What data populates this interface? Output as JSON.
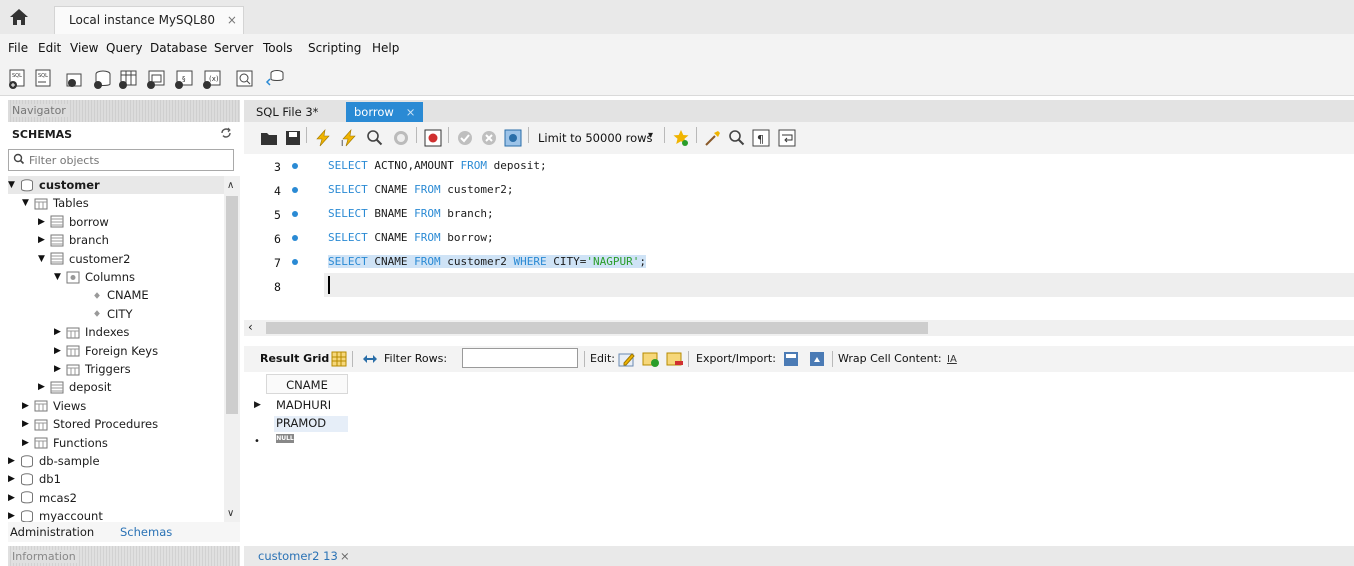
{
  "app": {
    "connection_tab": "Local instance MySQL80",
    "close_glyph": "×"
  },
  "menu": [
    "File",
    "Edit",
    "View",
    "Query",
    "Database",
    "Server",
    "Tools",
    "Scripting",
    "Help"
  ],
  "navigator": {
    "title": "Navigator",
    "schemas_header": "SCHEMAS",
    "filter_placeholder": "Filter objects",
    "tree": [
      {
        "label": "customer",
        "level": 0,
        "expanded": true,
        "kind": "schema",
        "bold": true
      },
      {
        "label": "Tables",
        "level": 1,
        "expanded": true,
        "kind": "folder"
      },
      {
        "label": "borrow",
        "level": 2,
        "expanded": false,
        "kind": "table"
      },
      {
        "label": "branch",
        "level": 2,
        "expanded": false,
        "kind": "table"
      },
      {
        "label": "customer2",
        "level": 2,
        "expanded": true,
        "kind": "table"
      },
      {
        "label": "Columns",
        "level": 3,
        "expanded": true,
        "kind": "columns"
      },
      {
        "label": "CNAME",
        "level": 4,
        "kind": "column"
      },
      {
        "label": "CITY",
        "level": 4,
        "kind": "column"
      },
      {
        "label": "Indexes",
        "level": 3,
        "expanded": false,
        "kind": "folder"
      },
      {
        "label": "Foreign Keys",
        "level": 3,
        "expanded": false,
        "kind": "folder"
      },
      {
        "label": "Triggers",
        "level": 3,
        "expanded": false,
        "kind": "folder"
      },
      {
        "label": "deposit",
        "level": 2,
        "expanded": false,
        "kind": "table"
      },
      {
        "label": "Views",
        "level": 1,
        "kind": "folder"
      },
      {
        "label": "Stored Procedures",
        "level": 1,
        "kind": "folder"
      },
      {
        "label": "Functions",
        "level": 1,
        "kind": "folder"
      },
      {
        "label": "db-sample",
        "level": 0,
        "expanded": false,
        "kind": "schema"
      },
      {
        "label": "db1",
        "level": 0,
        "expanded": false,
        "kind": "schema"
      },
      {
        "label": "mcas2",
        "level": 0,
        "expanded": false,
        "kind": "schema"
      },
      {
        "label": "myaccount",
        "level": 0,
        "expanded": false,
        "kind": "schema"
      }
    ],
    "bottom_tabs": [
      "Administration",
      "Schemas"
    ],
    "info_title": "Information"
  },
  "editor": {
    "tabs": [
      "SQL File 3*",
      "borrow"
    ],
    "limit_label": "Limit to 50000 rows",
    "lines": [
      {
        "num": "3",
        "tokens": [
          {
            "t": "SELECT",
            "c": "kw"
          },
          {
            "t": " ACTNO,AMOUNT ",
            "c": "ident"
          },
          {
            "t": "FROM",
            "c": "kw"
          },
          {
            "t": " deposit;",
            "c": "ident"
          }
        ]
      },
      {
        "num": "4",
        "tokens": [
          {
            "t": "SELECT",
            "c": "kw"
          },
          {
            "t": " CNAME ",
            "c": "ident"
          },
          {
            "t": "FROM",
            "c": "kw"
          },
          {
            "t": " customer2;",
            "c": "ident"
          }
        ]
      },
      {
        "num": "5",
        "tokens": [
          {
            "t": "SELECT",
            "c": "kw"
          },
          {
            "t": " BNAME ",
            "c": "ident"
          },
          {
            "t": "FROM",
            "c": "kw"
          },
          {
            "t": " branch;",
            "c": "ident"
          }
        ]
      },
      {
        "num": "6",
        "tokens": [
          {
            "t": "SELECT",
            "c": "kw"
          },
          {
            "t": " CNAME ",
            "c": "ident"
          },
          {
            "t": "FROM",
            "c": "kw"
          },
          {
            "t": " borrow;",
            "c": "ident"
          }
        ]
      },
      {
        "num": "7",
        "highlight": true,
        "tokens": [
          {
            "t": "SELECT",
            "c": "kw"
          },
          {
            "t": " CNAME ",
            "c": "ident"
          },
          {
            "t": "FROM",
            "c": "kw"
          },
          {
            "t": " customer2 ",
            "c": "ident"
          },
          {
            "t": "WHERE",
            "c": "kw"
          },
          {
            "t": " CITY=",
            "c": "ident"
          },
          {
            "t": "'NAGPUR'",
            "c": "str"
          },
          {
            "t": ";",
            "c": "ident"
          }
        ]
      },
      {
        "num": "8",
        "tokens": []
      }
    ]
  },
  "result": {
    "grid_label": "Result Grid",
    "filter_label": "Filter Rows:",
    "edit_label": "Edit:",
    "export_label": "Export/Import:",
    "wrap_label": "Wrap Cell Content:",
    "column": "CNAME",
    "rows": [
      "MADHURI",
      "PRAMOD"
    ],
    "null_text": "NULL"
  },
  "output_tab": "customer2 13",
  "colors": {
    "accent": "#2a8ad4",
    "keyword": "#2a8ad4",
    "string": "#2a9d2a"
  }
}
